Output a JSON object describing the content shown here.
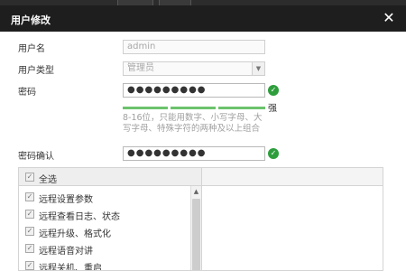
{
  "dialog": {
    "title": "用户修改",
    "close_icon": "close-icon"
  },
  "form": {
    "username": {
      "label": "用户名",
      "value": "admin"
    },
    "user_type": {
      "label": "用户类型",
      "value": "管理员"
    },
    "password": {
      "label": "密码",
      "value": "●●●●●●●●●",
      "strength": "强",
      "hint": "8-16位，只能用数字、小写字母、大写字母、特殊字符的两种及以上组合"
    },
    "confirm_password": {
      "label": "密码确认",
      "value": "●●●●●●●●●"
    }
  },
  "permissions": {
    "select_all": "全选",
    "items": [
      "远程设置参数",
      "远程查看日志、状态",
      "远程升级、格式化",
      "远程语音对讲",
      "远程关机、重启"
    ]
  },
  "colors": {
    "titlebar": "#1e1e1e",
    "valid_green": "#2e9e3c",
    "strength_bar": "#6cc36c"
  }
}
